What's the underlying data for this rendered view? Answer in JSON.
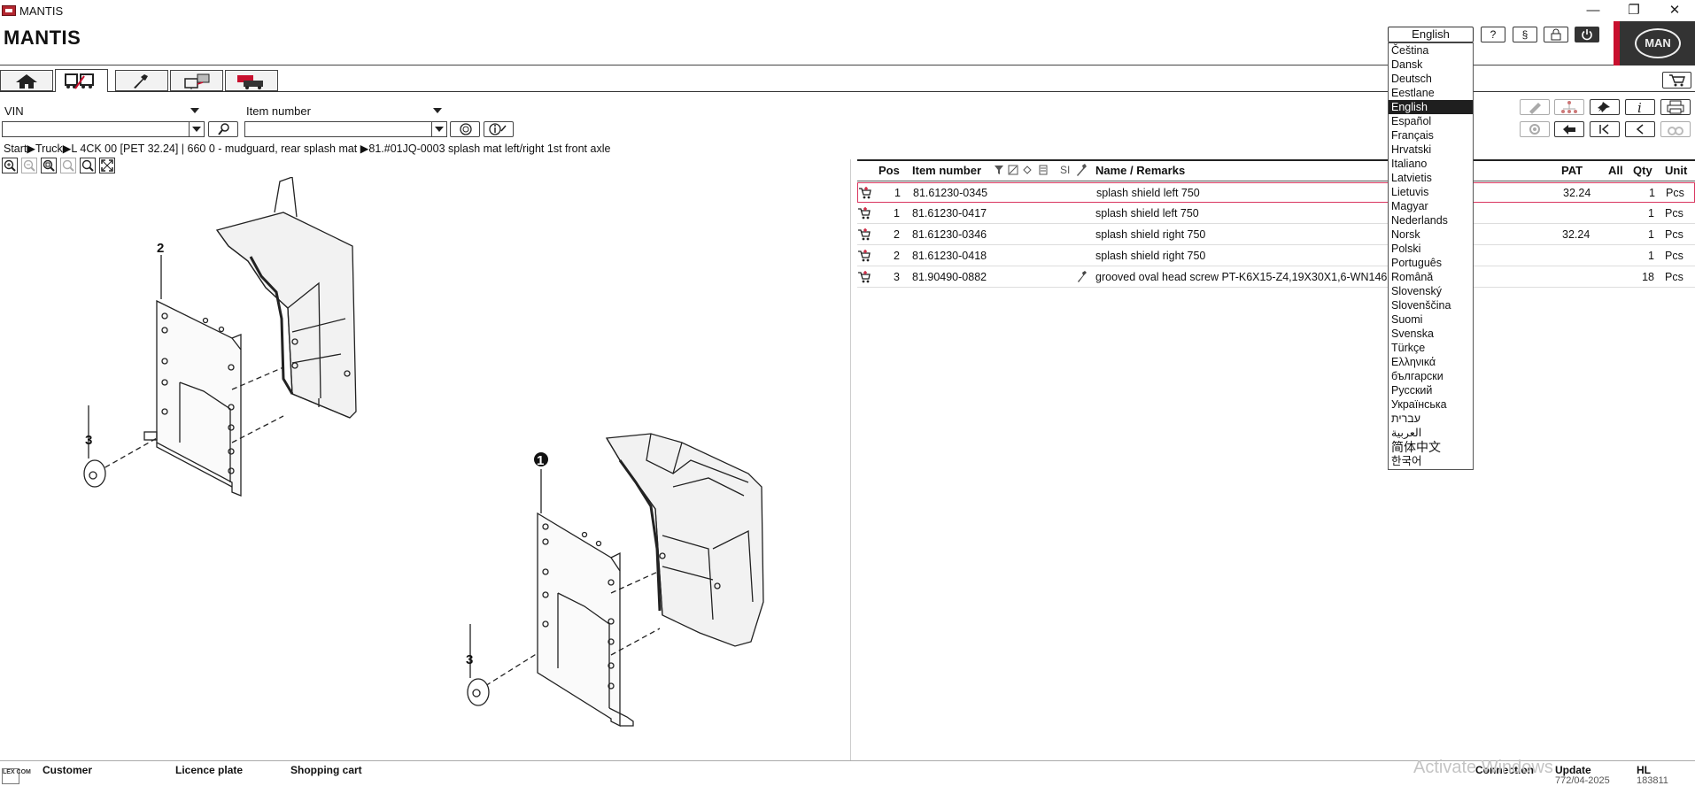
{
  "window": {
    "title": "MANTIS",
    "minimize": "—",
    "maximize": "❐",
    "close": "✕"
  },
  "app": {
    "title": "MANTIS",
    "logo_text": "MAN"
  },
  "header": {
    "language": "English",
    "help": "?",
    "legal": "§",
    "lock": "🔒",
    "power": "⏻"
  },
  "languages": [
    {
      "label": "Čeština"
    },
    {
      "label": "Dansk"
    },
    {
      "label": "Deutsch"
    },
    {
      "label": "Eestlane"
    },
    {
      "label": "English",
      "selected": true
    },
    {
      "label": "Español"
    },
    {
      "label": "Français"
    },
    {
      "label": "Hrvatski"
    },
    {
      "label": "Italiano"
    },
    {
      "label": "Latvietis"
    },
    {
      "label": "Lietuvis"
    },
    {
      "label": "Magyar"
    },
    {
      "label": "Nederlands"
    },
    {
      "label": "Norsk"
    },
    {
      "label": "Polski"
    },
    {
      "label": "Português"
    },
    {
      "label": "Română"
    },
    {
      "label": "Slovenský"
    },
    {
      "label": "Slovenščina"
    },
    {
      "label": "Suomi"
    },
    {
      "label": "Svenska"
    },
    {
      "label": "Türkçe"
    },
    {
      "label": "Ελληνικά"
    },
    {
      "label": "български"
    },
    {
      "label": "Русский"
    },
    {
      "label": "Українська"
    },
    {
      "label": "עברית"
    },
    {
      "label": "العربية"
    },
    {
      "label": "简体中文"
    },
    {
      "label": "한국어"
    }
  ],
  "tabs": [
    {
      "icon": "home-icon"
    },
    {
      "icon": "vehicle-icon",
      "active": true
    },
    {
      "icon": "tool-icon"
    },
    {
      "icon": "diagnosis-icon"
    },
    {
      "icon": "trucks-icon"
    }
  ],
  "search": {
    "vin_label": "VIN",
    "item_number_label": "Item number",
    "vin_value": "",
    "item_value": ""
  },
  "breadcrumb": "Start▶Truck▶L 4CK 00  [PET 32.24]  | 660 0 - mudguard, rear splash mat ▶81.#01JQ-0003  splash mat left/right 1st front axle",
  "drawing": {
    "callouts": [
      "2",
      "3",
      "1",
      "3"
    ]
  },
  "table": {
    "headers": {
      "pos": "Pos",
      "item": "Item number",
      "si": "SI",
      "name": "Name / Remarks",
      "pat": "PAT",
      "all": "All",
      "qty": "Qty",
      "unit": "Unit"
    },
    "rows": [
      {
        "pos": "1",
        "item": "81.61230-0345",
        "name": "splash shield left  750",
        "pat": "32.24",
        "qty": "1",
        "unit": "Pcs",
        "tool": false
      },
      {
        "pos": "1",
        "item": "81.61230-0417",
        "name": "splash shield left  750",
        "pat": "",
        "qty": "1",
        "unit": "Pcs",
        "tool": false
      },
      {
        "pos": "2",
        "item": "81.61230-0346",
        "name": "splash shield right  750",
        "pat": "32.24",
        "qty": "1",
        "unit": "Pcs",
        "tool": false
      },
      {
        "pos": "2",
        "item": "81.61230-0418",
        "name": "splash shield right  750",
        "pat": "",
        "qty": "1",
        "unit": "Pcs",
        "tool": false
      },
      {
        "pos": "3",
        "item": "81.90490-0882",
        "name": "grooved oval head screw  PT-K6X15-Z4,19X30X1,6-WN146",
        "pat": "",
        "qty": "18",
        "unit": "Pcs",
        "tool": true
      }
    ]
  },
  "status": {
    "logo": "LEX COM",
    "customer": "Customer",
    "licence_plate": "Licence plate",
    "shopping_cart": "Shopping cart",
    "connection": "Connection",
    "update": "Update",
    "update_value": "772/04-2025",
    "hl": "HL",
    "hl_value": "183811",
    "watermark": "Activate Windows"
  }
}
